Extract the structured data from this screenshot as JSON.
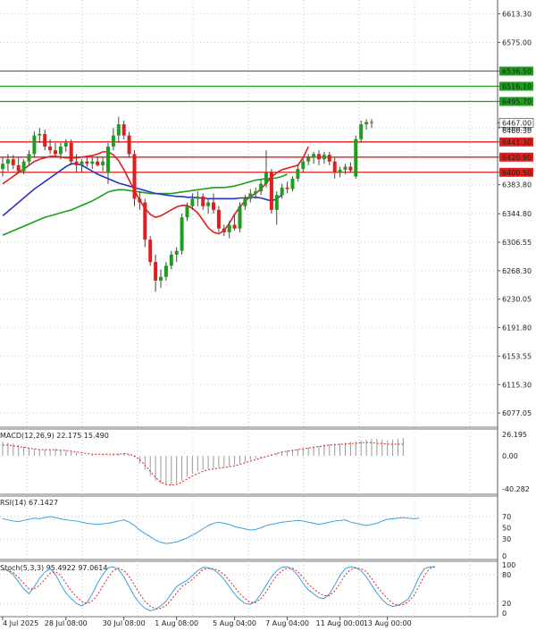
{
  "chart_data": {
    "type": "candlestick",
    "price_panel": {
      "ylim": [
        6058,
        6632
      ],
      "y_ticks": [
        "6613.30",
        "6575.00",
        "6536.50",
        "6516.10",
        "6495.70",
        "6467.00",
        "6460.30",
        "6441.30",
        "6420.90",
        "6400.50",
        "6383.80",
        "6344.80",
        "6306.55",
        "6268.30",
        "6230.05",
        "6191.80",
        "6153.55",
        "6115.30",
        "6077.05"
      ],
      "green_levels": [
        {
          "value": 6536.5,
          "label": "6536.50"
        },
        {
          "value": 6516.1,
          "label": "6516.10"
        },
        {
          "value": 6495.7,
          "label": "6495.70"
        }
      ],
      "red_levels": [
        {
          "value": 6441.3,
          "label": "6441.30"
        },
        {
          "value": 6420.9,
          "label": "6420.90"
        },
        {
          "value": 6400.5,
          "label": "6400.50"
        }
      ],
      "current_price": {
        "value": 6467.0,
        "label": "6467.00"
      },
      "candles": [
        {
          "o": 6405,
          "h": 6420,
          "l": 6395,
          "c": 6412
        },
        {
          "o": 6412,
          "h": 6425,
          "l": 6402,
          "c": 6418
        },
        {
          "o": 6418,
          "h": 6424,
          "l": 6405,
          "c": 6410
        },
        {
          "o": 6410,
          "h": 6420,
          "l": 6400,
          "c": 6402
        },
        {
          "o": 6402,
          "h": 6418,
          "l": 6398,
          "c": 6415
        },
        {
          "o": 6415,
          "h": 6430,
          "l": 6410,
          "c": 6425
        },
        {
          "o": 6425,
          "h": 6455,
          "l": 6420,
          "c": 6450
        },
        {
          "o": 6450,
          "h": 6460,
          "l": 6440,
          "c": 6452
        },
        {
          "o": 6452,
          "h": 6458,
          "l": 6430,
          "c": 6435
        },
        {
          "o": 6435,
          "h": 6445,
          "l": 6425,
          "c": 6430
        },
        {
          "o": 6430,
          "h": 6440,
          "l": 6420,
          "c": 6425
        },
        {
          "o": 6425,
          "h": 6440,
          "l": 6418,
          "c": 6435
        },
        {
          "o": 6435,
          "h": 6445,
          "l": 6428,
          "c": 6440
        },
        {
          "o": 6440,
          "h": 6445,
          "l": 6410,
          "c": 6415
        },
        {
          "o": 6415,
          "h": 6425,
          "l": 6400,
          "c": 6410
        },
        {
          "o": 6410,
          "h": 6418,
          "l": 6400,
          "c": 6415
        },
        {
          "o": 6415,
          "h": 6422,
          "l": 6408,
          "c": 6412
        },
        {
          "o": 6412,
          "h": 6420,
          "l": 6405,
          "c": 6415
        },
        {
          "o": 6415,
          "h": 6422,
          "l": 6408,
          "c": 6410
        },
        {
          "o": 6410,
          "h": 6420,
          "l": 6402,
          "c": 6415
        },
        {
          "o": 6400,
          "h": 6440,
          "l": 6385,
          "c": 6435
        },
        {
          "o": 6435,
          "h": 6460,
          "l": 6430,
          "c": 6450
        },
        {
          "o": 6450,
          "h": 6475,
          "l": 6440,
          "c": 6465
        },
        {
          "o": 6465,
          "h": 6470,
          "l": 6445,
          "c": 6450
        },
        {
          "o": 6450,
          "h": 6455,
          "l": 6420,
          "c": 6425
        },
        {
          "o": 6425,
          "h": 6430,
          "l": 6355,
          "c": 6365
        },
        {
          "o": 6365,
          "h": 6375,
          "l": 6350,
          "c": 6360
        },
        {
          "o": 6360,
          "h": 6365,
          "l": 6300,
          "c": 6310
        },
        {
          "o": 6310,
          "h": 6315,
          "l": 6275,
          "c": 6280
        },
        {
          "o": 6280,
          "h": 6290,
          "l": 6240,
          "c": 6255
        },
        {
          "o": 6255,
          "h": 6270,
          "l": 6245,
          "c": 6260
        },
        {
          "o": 6260,
          "h": 6280,
          "l": 6255,
          "c": 6275
        },
        {
          "o": 6275,
          "h": 6295,
          "l": 6270,
          "c": 6290
        },
        {
          "o": 6290,
          "h": 6300,
          "l": 6280,
          "c": 6295
        },
        {
          "o": 6295,
          "h": 6345,
          "l": 6290,
          "c": 6340
        },
        {
          "o": 6340,
          "h": 6360,
          "l": 6335,
          "c": 6355
        },
        {
          "o": 6355,
          "h": 6372,
          "l": 6350,
          "c": 6365
        },
        {
          "o": 6365,
          "h": 6375,
          "l": 6355,
          "c": 6368
        },
        {
          "o": 6368,
          "h": 6372,
          "l": 6350,
          "c": 6355
        },
        {
          "o": 6355,
          "h": 6365,
          "l": 6345,
          "c": 6360
        },
        {
          "o": 6360,
          "h": 6372,
          "l": 6345,
          "c": 6350
        },
        {
          "o": 6350,
          "h": 6355,
          "l": 6320,
          "c": 6325
        },
        {
          "o": 6325,
          "h": 6330,
          "l": 6315,
          "c": 6320
        },
        {
          "o": 6320,
          "h": 6335,
          "l": 6312,
          "c": 6330
        },
        {
          "o": 6330,
          "h": 6345,
          "l": 6322,
          "c": 6325
        },
        {
          "o": 6325,
          "h": 6360,
          "l": 6320,
          "c": 6355
        },
        {
          "o": 6355,
          "h": 6370,
          "l": 6350,
          "c": 6365
        },
        {
          "o": 6365,
          "h": 6378,
          "l": 6360,
          "c": 6372
        },
        {
          "o": 6372,
          "h": 6380,
          "l": 6365,
          "c": 6375
        },
        {
          "o": 6375,
          "h": 6390,
          "l": 6370,
          "c": 6385
        },
        {
          "o": 6385,
          "h": 6430,
          "l": 6380,
          "c": 6400
        },
        {
          "o": 6400,
          "h": 6405,
          "l": 6345,
          "c": 6350
        },
        {
          "o": 6350,
          "h": 6375,
          "l": 6330,
          "c": 6370
        },
        {
          "o": 6370,
          "h": 6385,
          "l": 6365,
          "c": 6380
        },
        {
          "o": 6380,
          "h": 6388,
          "l": 6372,
          "c": 6378
        },
        {
          "o": 6378,
          "h": 6395,
          "l": 6375,
          "c": 6392
        },
        {
          "o": 6392,
          "h": 6410,
          "l": 6388,
          "c": 6405
        },
        {
          "o": 6405,
          "h": 6418,
          "l": 6400,
          "c": 6415
        },
        {
          "o": 6415,
          "h": 6425,
          "l": 6410,
          "c": 6420
        },
        {
          "o": 6420,
          "h": 6428,
          "l": 6412,
          "c": 6425
        },
        {
          "o": 6425,
          "h": 6430,
          "l": 6410,
          "c": 6418
        },
        {
          "o": 6418,
          "h": 6428,
          "l": 6412,
          "c": 6424
        },
        {
          "o": 6424,
          "h": 6428,
          "l": 6410,
          "c": 6415
        },
        {
          "o": 6415,
          "h": 6420,
          "l": 6392,
          "c": 6400
        },
        {
          "o": 6400,
          "h": 6408,
          "l": 6394,
          "c": 6404
        },
        {
          "o": 6404,
          "h": 6412,
          "l": 6398,
          "c": 6408
        },
        {
          "o": 6408,
          "h": 6414,
          "l": 6400,
          "c": 6403
        },
        {
          "o": 6395,
          "h": 6450,
          "l": 6392,
          "c": 6445
        },
        {
          "o": 6445,
          "h": 6470,
          "l": 6440,
          "c": 6465
        },
        {
          "o": 6465,
          "h": 6472,
          "l": 6458,
          "c": 6468
        },
        {
          "o": 6468,
          "h": 6472,
          "l": 6460,
          "c": 6467
        }
      ],
      "ma_red": [
        6385,
        6390,
        6395,
        6400,
        6405,
        6410,
        6415,
        6418,
        6420,
        6422,
        6422,
        6421,
        6420,
        6420,
        6420,
        6421,
        6422,
        6423,
        6425,
        6428,
        6428,
        6424,
        6416,
        6404,
        6390,
        6376,
        6363,
        6352,
        6344,
        6340,
        6342,
        6346,
        6350,
        6354,
        6356,
        6356,
        6352,
        6346,
        6336,
        6326,
        6320,
        6318,
        6322,
        6332,
        6344,
        6354,
        6362,
        6368,
        6372,
        6378,
        6386,
        6394,
        6400,
        6404,
        6406,
        6408,
        6410,
        6420,
        6435
      ],
      "ma_blue": [
        6342,
        6348,
        6354,
        6360,
        6366,
        6372,
        6378,
        6383,
        6388,
        6393,
        6398,
        6403,
        6408,
        6412,
        6412,
        6410,
        6406,
        6402,
        6398,
        6395,
        6392,
        6389,
        6386,
        6384,
        6382,
        6380,
        6378,
        6376,
        6374,
        6372,
        6371,
        6370,
        6369,
        6368,
        6368,
        6367,
        6367,
        6366,
        6366,
        6365,
        6365,
        6365,
        6365,
        6365,
        6365,
        6366,
        6366,
        6367,
        6367,
        6366,
        6364,
        6362,
        6365,
        6370
      ],
      "ma_green": [
        6316,
        6319,
        6322,
        6325,
        6328,
        6331,
        6334,
        6337,
        6340,
        6342,
        6344,
        6346,
        6348,
        6350,
        6353,
        6356,
        6359,
        6362,
        6366,
        6370,
        6374,
        6376,
        6377,
        6377,
        6376,
        6375,
        6374,
        6373,
        6372,
        6372,
        6372,
        6372,
        6372,
        6373,
        6374,
        6375,
        6376,
        6377,
        6378,
        6379,
        6380,
        6380,
        6380,
        6381,
        6382,
        6384,
        6386,
        6388,
        6390,
        6391,
        6392,
        6392,
        6393,
        6395,
        6398
      ]
    },
    "macd_panel": {
      "label": "MACD(12,26,9) 22.175 15.490",
      "ylim": [
        -45,
        30
      ],
      "y_ticks": [
        "26.195",
        "0.00",
        "-40.282"
      ],
      "histogram": [
        18,
        17,
        16,
        14,
        12,
        10,
        9,
        8,
        8,
        8,
        9,
        8,
        7,
        6,
        4,
        2,
        1,
        1,
        0,
        1,
        1,
        2,
        3,
        3,
        2,
        -2,
        -10,
        -18,
        -26,
        -32,
        -36,
        -38,
        -38,
        -36,
        -32,
        -27,
        -23,
        -20,
        -18,
        -17,
        -16,
        -15,
        -14,
        -13,
        -12,
        -10,
        -8,
        -6,
        -4,
        -2,
        0,
        2,
        4,
        6,
        7,
        8,
        9,
        10,
        11,
        12,
        13,
        14,
        15,
        16,
        16,
        17,
        18,
        19,
        20,
        21,
        22,
        22,
        21,
        20,
        21,
        22,
        23
      ],
      "signal": [
        14,
        14,
        13,
        12,
        11,
        10,
        9,
        8,
        8,
        8,
        8,
        7,
        7,
        6,
        5,
        4,
        3,
        2,
        2,
        2,
        2,
        2,
        2,
        3,
        2,
        0,
        -5,
        -12,
        -20,
        -28,
        -34,
        -37,
        -38,
        -37,
        -34,
        -30,
        -26,
        -23,
        -20,
        -18,
        -17,
        -16,
        -15,
        -14,
        -13,
        -11,
        -9,
        -7,
        -5,
        -3,
        -1,
        1,
        3,
        5,
        6,
        7,
        8,
        9,
        10,
        11,
        12,
        13,
        14,
        14,
        15,
        15,
        16,
        16,
        17,
        17,
        17,
        16,
        16,
        15,
        15,
        15,
        15
      ]
    },
    "rsi_panel": {
      "label": "RSI(14) 67.1427",
      "ylim": [
        0,
        100
      ],
      "y_ticks": [
        "70",
        "50",
        "30",
        "0"
      ],
      "values": [
        66,
        64,
        62,
        61,
        63,
        65,
        67,
        66,
        68,
        70,
        68,
        66,
        64,
        63,
        62,
        60,
        58,
        57,
        56,
        57,
        58,
        60,
        62,
        64,
        60,
        54,
        46,
        40,
        34,
        28,
        24,
        22,
        23,
        25,
        28,
        32,
        37,
        42,
        48,
        54,
        58,
        60,
        58,
        56,
        52,
        50,
        48,
        46,
        47,
        50,
        54,
        56,
        58,
        60,
        61,
        62,
        63,
        62,
        60,
        58,
        56,
        58,
        60,
        62,
        63,
        64,
        60,
        58,
        56,
        54,
        56,
        58,
        62,
        65,
        66,
        67,
        68,
        67,
        66,
        67
      ]
    },
    "stoch_panel": {
      "label": "Stoch(5,3,3) 95.4922 97.0614",
      "ylim": [
        0,
        100
      ],
      "y_ticks": [
        "100",
        "80",
        "20",
        "0"
      ],
      "k": [
        92,
        88,
        80,
        65,
        50,
        40,
        55,
        72,
        85,
        92,
        80,
        60,
        42,
        30,
        20,
        15,
        22,
        40,
        62,
        80,
        94,
        96,
        90,
        75,
        55,
        35,
        20,
        10,
        5,
        8,
        15,
        25,
        40,
        55,
        62,
        68,
        78,
        88,
        95,
        94,
        90,
        82,
        70,
        55,
        40,
        28,
        20,
        18,
        25,
        40,
        58,
        75,
        88,
        95,
        96,
        90,
        78,
        62,
        48,
        40,
        32,
        30,
        40,
        58,
        78,
        92,
        96,
        94,
        88,
        75,
        58,
        42,
        28,
        18,
        14,
        16,
        22,
        30,
        50,
        75,
        92,
        96,
        95
      ],
      "d": [
        90,
        89,
        84,
        74,
        62,
        50,
        50,
        58,
        70,
        83,
        86,
        78,
        62,
        46,
        34,
        24,
        20,
        25,
        38,
        56,
        74,
        88,
        93,
        88,
        76,
        58,
        40,
        24,
        14,
        9,
        10,
        16,
        28,
        42,
        55,
        62,
        70,
        80,
        90,
        93,
        92,
        88,
        80,
        68,
        54,
        40,
        30,
        22,
        22,
        30,
        44,
        62,
        78,
        88,
        93,
        93,
        86,
        74,
        60,
        50,
        42,
        36,
        36,
        46,
        62,
        80,
        90,
        94,
        92,
        86,
        72,
        56,
        42,
        30,
        20,
        16,
        18,
        24,
        36,
        56,
        78,
        92,
        97
      ]
    },
    "x_ticks": [
      {
        "label": "4 Jul 2025",
        "i": 0
      },
      {
        "label": "28 Jul 08:00",
        "i": 12
      },
      {
        "label": "30 Jul 08:00",
        "i": 23
      },
      {
        "label": "1 Aug 08:00",
        "i": 33
      },
      {
        "label": "5 Aug 04:00",
        "i": 44
      },
      {
        "label": "7 Aug 04:00",
        "i": 54
      },
      {
        "label": "11 Aug 00:00",
        "i": 64
      },
      {
        "label": "13 Aug 00:00",
        "i": 73
      }
    ]
  }
}
